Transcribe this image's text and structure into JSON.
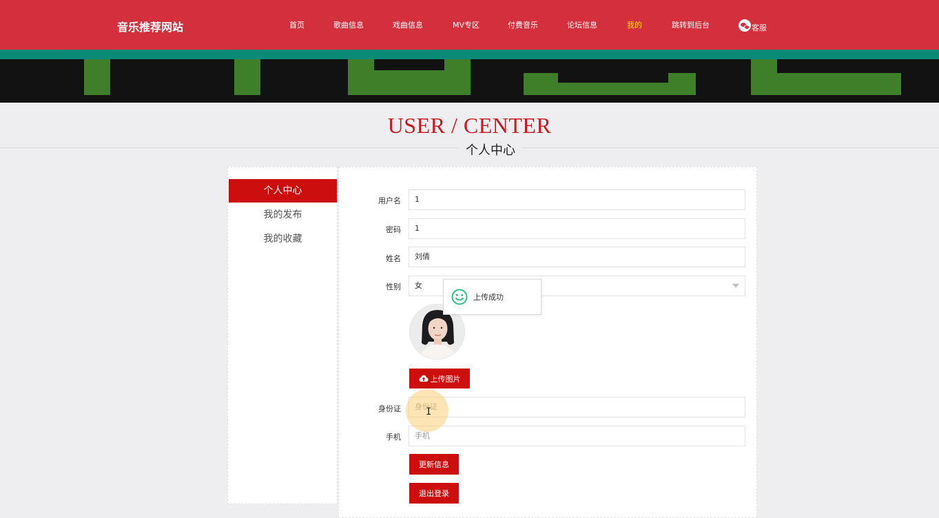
{
  "header": {
    "site_title": "音乐推荐网站",
    "nav": [
      {
        "label": "首页",
        "active": false
      },
      {
        "label": "歌曲信息",
        "active": false
      },
      {
        "label": "戏曲信息",
        "active": false
      },
      {
        "label": "MV专区",
        "active": false
      },
      {
        "label": "付费音乐",
        "active": false
      },
      {
        "label": "论坛信息",
        "active": false
      },
      {
        "label": "我的",
        "active": true
      },
      {
        "label": "跳转到后台",
        "active": false
      }
    ],
    "service_label": "客服",
    "service_icon": "wechat-icon"
  },
  "section": {
    "title": "USER / CENTER",
    "subtitle": "个人中心"
  },
  "sidebar": {
    "items": [
      {
        "label": "个人中心",
        "active": true
      },
      {
        "label": "我的发布",
        "active": false
      },
      {
        "label": "我的收藏",
        "active": false
      }
    ]
  },
  "form": {
    "username": {
      "label": "用户名",
      "value": "1"
    },
    "password": {
      "label": "密码",
      "value": "1"
    },
    "name": {
      "label": "姓名",
      "value": "刘倩"
    },
    "gender": {
      "label": "性别",
      "value": "女"
    },
    "upload_button": "上传图片",
    "id_card": {
      "label": "身份证",
      "placeholder": "身份证"
    },
    "phone": {
      "label": "手机",
      "placeholder": "手机"
    },
    "update_button": "更新信息",
    "logout_button": "退出登录"
  },
  "toast": {
    "message": "上传成功",
    "icon": "smile-icon"
  },
  "colors": {
    "header_bg": "#d42f3c",
    "accent_red": "#cc0e0e",
    "teal_strip": "#0b8a78",
    "nav_active": "#ffe400",
    "title_red": "#c9191f",
    "toast_icon": "#2ec27e"
  }
}
